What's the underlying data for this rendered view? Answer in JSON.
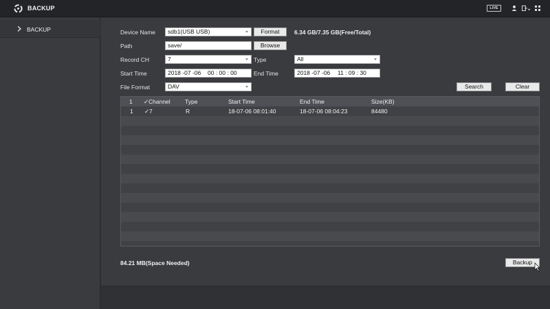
{
  "app": {
    "title": "BACKUP",
    "live_label": "LIVE"
  },
  "sidebar": {
    "items": [
      {
        "label": "BACKUP"
      }
    ]
  },
  "form": {
    "device_name": {
      "label": "Device Name",
      "value": "sdb1(USB USB)",
      "format_label": "Format",
      "capacity": "6.34 GB/7.35 GB(Free/Total)"
    },
    "path": {
      "label": "Path",
      "value": "save/",
      "browse_label": "Browse"
    },
    "record_ch": {
      "label": "Record CH",
      "value": "7"
    },
    "type": {
      "label": "Type",
      "value": "All"
    },
    "start_time": {
      "label": "Start Time",
      "date": "2018 -07 -06",
      "time": "00 : 00 : 00"
    },
    "end_time": {
      "label": "End Time",
      "date": "2018 -07 -06",
      "time": "11 : 09 : 30"
    },
    "file_format": {
      "label": "File Format",
      "value": "DAV"
    },
    "search_label": "Search",
    "clear_label": "Clear"
  },
  "table": {
    "headers": {
      "index": "1",
      "channel": "Channel",
      "type": "Type",
      "start": "Start Time",
      "end": "End Time",
      "size": "Size(KB)"
    },
    "rows": [
      {
        "index": "1",
        "channel": "7",
        "type": "R",
        "start": "18-07-06 08:01:40",
        "end": "18-07-06 08:04:23",
        "size": "84480"
      }
    ]
  },
  "footer": {
    "space_needed": "84.21 MB(Space Needed)",
    "backup_label": "Backup"
  }
}
